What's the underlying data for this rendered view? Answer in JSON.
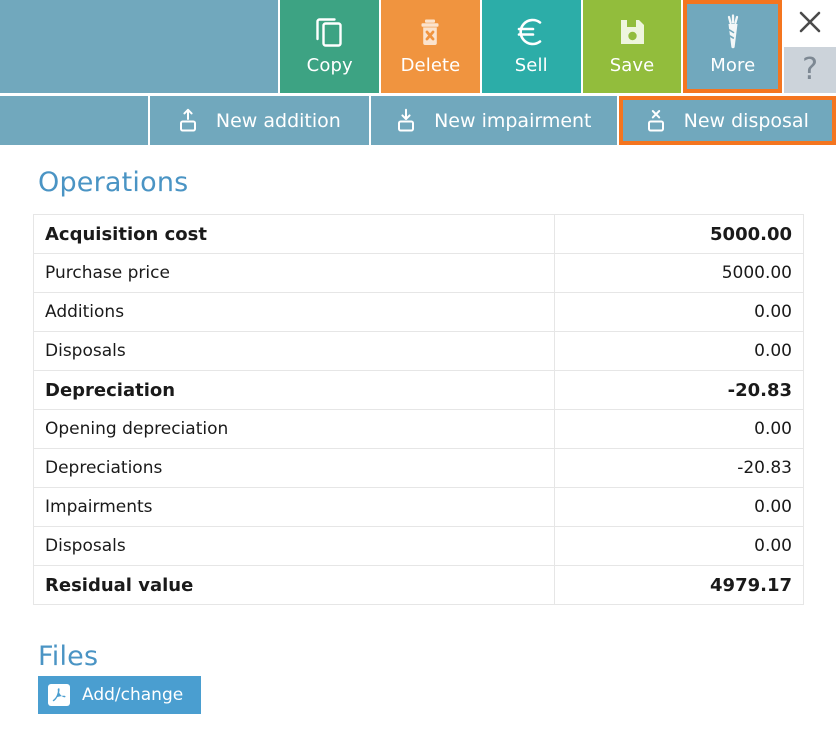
{
  "toolbar": {
    "buttons": [
      {
        "label": "Copy",
        "icon": "copy-icon",
        "color": "#3da383"
      },
      {
        "label": "Delete",
        "icon": "trash-x-icon",
        "color": "#f0943f"
      },
      {
        "label": "Sell",
        "icon": "euro-icon",
        "color": "#2cada8"
      },
      {
        "label": "Save",
        "icon": "floppy-disk-icon",
        "color": "#92bd3c"
      },
      {
        "label": "More",
        "icon": "carrot-icon",
        "color": "#71a8bd",
        "selected": true
      }
    ],
    "close_icon": "close-x-icon",
    "help_label": "?",
    "highlight_color": "#f4751f"
  },
  "tabs": [
    {
      "label": "New addition",
      "icon": "box-up-arrow-icon",
      "selected": false
    },
    {
      "label": "New impairment",
      "icon": "box-down-arrow-icon",
      "selected": false
    },
    {
      "label": "New disposal",
      "icon": "box-x-icon",
      "selected": true
    }
  ],
  "operations": {
    "title": "Operations",
    "rows": [
      {
        "label": "Acquisition cost",
        "value": "5000.00",
        "strong": true
      },
      {
        "label": "Purchase price",
        "value": "5000.00",
        "strong": false
      },
      {
        "label": "Additions",
        "value": "0.00",
        "strong": false
      },
      {
        "label": "Disposals",
        "value": "0.00",
        "strong": false
      },
      {
        "label": "Depreciation",
        "value": "-20.83",
        "strong": true
      },
      {
        "label": "Opening depreciation",
        "value": "0.00",
        "strong": false
      },
      {
        "label": "Depreciations",
        "value": "-20.83",
        "strong": false
      },
      {
        "label": "Impairments",
        "value": "0.00",
        "strong": false
      },
      {
        "label": "Disposals",
        "value": "0.00",
        "strong": false
      },
      {
        "label": "Residual value",
        "value": "4979.17",
        "strong": true
      }
    ]
  },
  "files": {
    "title": "Files",
    "add_change_label": "Add/change",
    "add_change_icon": "pdf-icon"
  },
  "colors": {
    "accent_blue": "#4a94c4",
    "steel_blue": "#71a8bd",
    "highlight_orange": "#f4751f",
    "button_blue": "#4a9ed0"
  }
}
